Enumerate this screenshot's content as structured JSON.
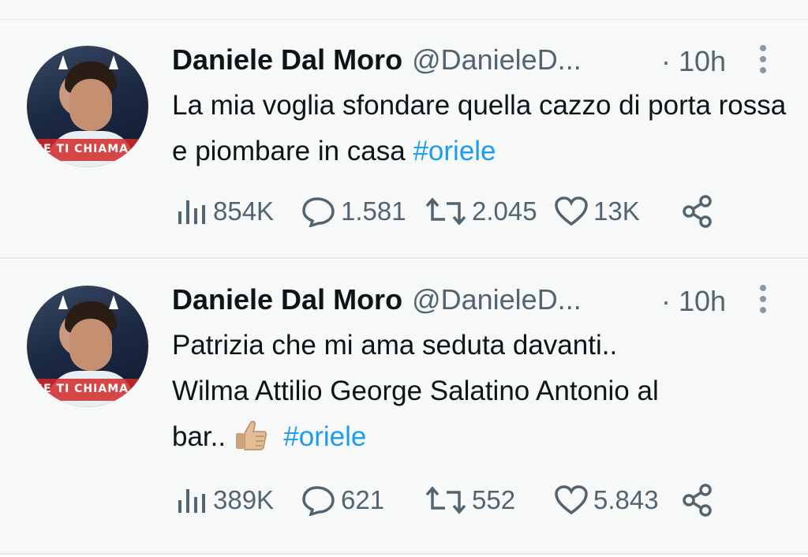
{
  "tweets": [
    {
      "author_name": "Daniele Dal Moro",
      "handle": "@DanieleD...",
      "time": "· 10h",
      "text_parts": [
        "La mia voglia sfondare quella cazzo di porta rossa e piombare in casa "
      ],
      "hashtag": "#oriele",
      "avatar_band_text": "SE TI CHIAMA",
      "views": "854K",
      "replies": "1.581",
      "retweets": "2.045",
      "likes": "13K"
    },
    {
      "author_name": "Daniele Dal Moro",
      "handle": "@DanieleD...",
      "time": "· 10h",
      "text_line1": "Patrizia che mi ama seduta davanti..",
      "text_line2": "Wilma Attilio George Salatino Antonio al",
      "text_line3_prefix": "bar.. ",
      "hashtag": "#oriele",
      "avatar_band_text": "SE TI CHIAMA",
      "views": "389K",
      "replies": "621",
      "retweets": "552",
      "likes": "5.843"
    }
  ],
  "icons": {
    "views": "bar-chart-icon",
    "reply": "speech-bubble-icon",
    "retweet": "retweet-icon",
    "like": "heart-icon",
    "share": "share-icon",
    "more": "more-vertical-icon",
    "emoji": "thumbs-up-emoji"
  },
  "colors": {
    "hashtag": "#1d9bf0",
    "secondary_text": "#536471",
    "background": "#f7f9f9"
  }
}
